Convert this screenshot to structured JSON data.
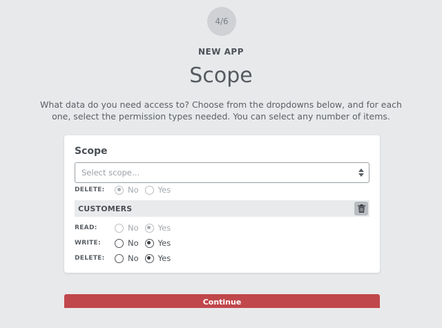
{
  "wizard": {
    "step": "4/6",
    "eyebrow": "NEW APP",
    "title": "Scope",
    "intro": "What data do you need access to? Choose from the dropdowns below, and for each one, select the permission types needed. You can select any number of items."
  },
  "card": {
    "title": "Scope",
    "select_placeholder": "Select scope…",
    "prev_group_delete": {
      "label": "DELETE:",
      "no": "No",
      "yes": "Yes",
      "selected": "no"
    },
    "group": {
      "name": "CUSTOMERS",
      "delete_icon": "trash-icon",
      "permissions": [
        {
          "label": "READ:",
          "no": "No",
          "yes": "Yes",
          "selected": "yes",
          "disabled": true
        },
        {
          "label": "WRITE:",
          "no": "No",
          "yes": "Yes",
          "selected": "yes",
          "disabled": false
        },
        {
          "label": "DELETE:",
          "no": "No",
          "yes": "Yes",
          "selected": "yes",
          "disabled": false
        }
      ]
    }
  },
  "actions": {
    "continue_label": "Continue"
  },
  "colors": {
    "accent": "#c0474b",
    "background": "#e8e9eb"
  }
}
